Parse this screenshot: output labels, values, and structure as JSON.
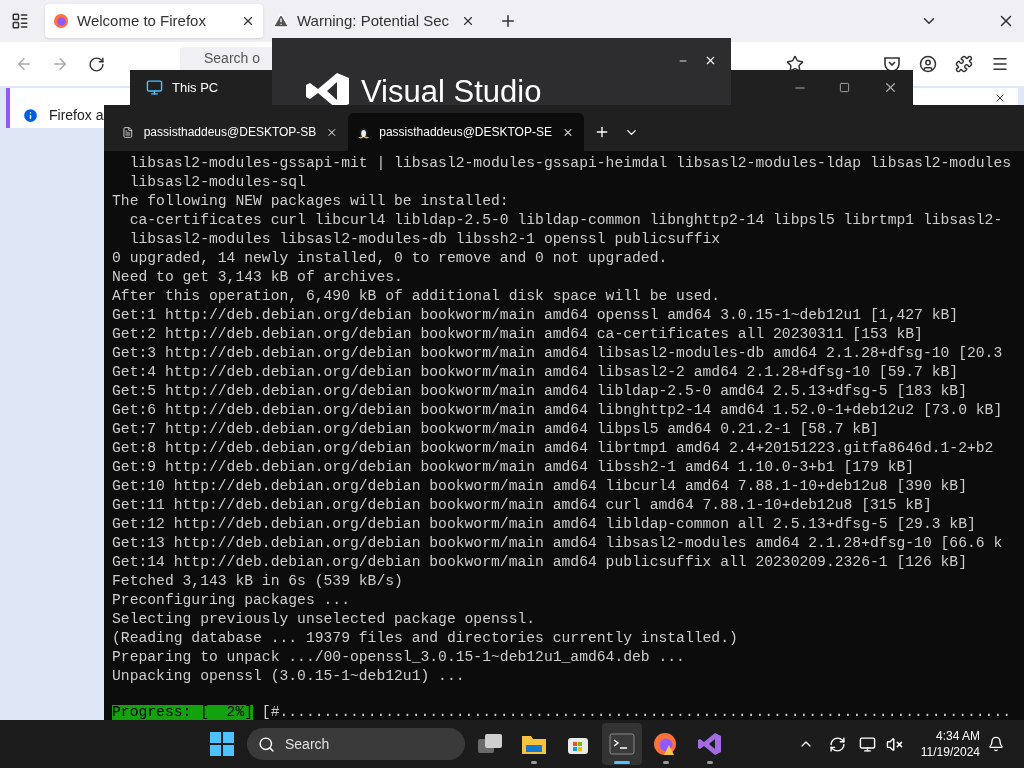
{
  "browser": {
    "tabs": [
      {
        "label": "Welcome to Firefox",
        "kind": "firefox",
        "selected": true
      },
      {
        "label": "Warning: Potential Sec",
        "kind": "warning",
        "selected": false
      }
    ],
    "address_placeholder": "Search o",
    "notification": "Firefox a"
  },
  "explorer": {
    "title": "This PC"
  },
  "splash": {
    "title": "Visual Studio"
  },
  "terminal": {
    "tabs": [
      {
        "label": "passisthaddeus@DESKTOP-SB",
        "kind": "cmd",
        "selected": false
      },
      {
        "label": "passisthaddeus@DESKTOP-SE",
        "kind": "linux",
        "selected": true
      }
    ],
    "lines": [
      "  libsasl2-modules-gssapi-mit | libsasl2-modules-gssapi-heimdal libsasl2-modules-ldap libsasl2-modules",
      "  libsasl2-modules-sql",
      "The following NEW packages will be installed:",
      "  ca-certificates curl libcurl4 libldap-2.5-0 libldap-common libnghttp2-14 libpsl5 librtmp1 libsasl2-",
      "  libsasl2-modules libsasl2-modules-db libssh2-1 openssl publicsuffix",
      "0 upgraded, 14 newly installed, 0 to remove and 0 not upgraded.",
      "Need to get 3,143 kB of archives.",
      "After this operation, 6,490 kB of additional disk space will be used.",
      "Get:1 http://deb.debian.org/debian bookworm/main amd64 openssl amd64 3.0.15-1~deb12u1 [1,427 kB]",
      "Get:2 http://deb.debian.org/debian bookworm/main amd64 ca-certificates all 20230311 [153 kB]",
      "Get:3 http://deb.debian.org/debian bookworm/main amd64 libsasl2-modules-db amd64 2.1.28+dfsg-10 [20.3",
      "Get:4 http://deb.debian.org/debian bookworm/main amd64 libsasl2-2 amd64 2.1.28+dfsg-10 [59.7 kB]",
      "Get:5 http://deb.debian.org/debian bookworm/main amd64 libldap-2.5-0 amd64 2.5.13+dfsg-5 [183 kB]",
      "Get:6 http://deb.debian.org/debian bookworm/main amd64 libnghttp2-14 amd64 1.52.0-1+deb12u2 [73.0 kB]",
      "Get:7 http://deb.debian.org/debian bookworm/main amd64 libpsl5 amd64 0.21.2-1 [58.7 kB]",
      "Get:8 http://deb.debian.org/debian bookworm/main amd64 librtmp1 amd64 2.4+20151223.gitfa8646d.1-2+b2",
      "Get:9 http://deb.debian.org/debian bookworm/main amd64 libssh2-1 amd64 1.10.0-3+b1 [179 kB]",
      "Get:10 http://deb.debian.org/debian bookworm/main amd64 libcurl4 amd64 7.88.1-10+deb12u8 [390 kB]",
      "Get:11 http://deb.debian.org/debian bookworm/main amd64 curl amd64 7.88.1-10+deb12u8 [315 kB]",
      "Get:12 http://deb.debian.org/debian bookworm/main amd64 libldap-common all 2.5.13+dfsg-5 [29.3 kB]",
      "Get:13 http://deb.debian.org/debian bookworm/main amd64 libsasl2-modules amd64 2.1.28+dfsg-10 [66.6 k",
      "Get:14 http://deb.debian.org/debian bookworm/main amd64 publicsuffix all 20230209.2326-1 [126 kB]",
      "Fetched 3,143 kB in 6s (539 kB/s)",
      "Preconfiguring packages ...",
      "Selecting previously unselected package openssl.",
      "(Reading database ... 19379 files and directories currently installed.)",
      "Preparing to unpack .../00-openssl_3.0.15-1~deb12u1_amd64.deb ...",
      "Unpacking openssl (3.0.15-1~deb12u1) ..."
    ],
    "progress": {
      "label": "Progress: [  2%]",
      "bar": "[#..................................................................................."
    }
  },
  "taskbar": {
    "search_placeholder": "Search",
    "apps": [
      {
        "kind": "taskview",
        "running": false,
        "selected": false
      },
      {
        "kind": "explorer",
        "running": true,
        "selected": false
      },
      {
        "kind": "store",
        "running": false,
        "selected": false
      },
      {
        "kind": "terminal",
        "running": true,
        "selected": true
      },
      {
        "kind": "firefox",
        "running": true,
        "selected": false
      },
      {
        "kind": "vs",
        "running": true,
        "selected": false
      }
    ],
    "time": "4:34 AM",
    "date": "11/19/2024"
  }
}
